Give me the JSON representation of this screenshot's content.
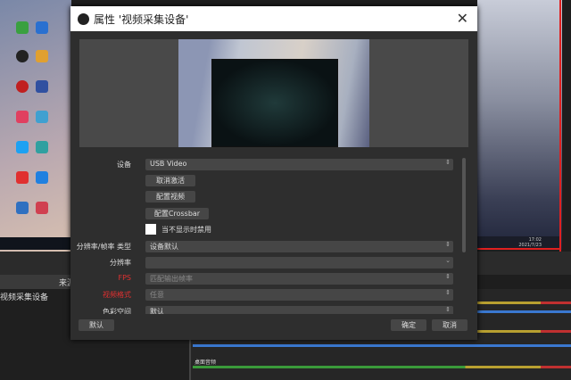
{
  "dialog": {
    "title": "属性 '视频采集设备'",
    "fields": {
      "device_label": "设备",
      "device_value": "USB Video",
      "deactivate_button": "取消激活",
      "configure_video_button": "配置视频",
      "configure_crossbar_button": "配置Crossbar",
      "disable_when_hidden_label": "当不显示时禁用",
      "res_type_label": "分辨率/帧率 类型",
      "res_type_value": "设备默认",
      "resolution_label": "分辨率",
      "resolution_value": "",
      "fps_label": "FPS",
      "fps_value": "匹配输出帧率",
      "video_format_label": "视频格式",
      "video_format_value": "任意",
      "color_space_label": "色彩空间",
      "color_space_value": "默认"
    },
    "defaults_button": "默认",
    "ok_button": "确定",
    "cancel_button": "取消"
  },
  "obs": {
    "sources_header": "来源",
    "source_item": "视频采集设备",
    "mixer_track": "桌面音频"
  },
  "preview": {
    "clock_time": "17:02",
    "clock_date": "2021/7/23"
  },
  "colors": {
    "accent_red": "#e02020",
    "meter_blue": "#3a78d0"
  }
}
